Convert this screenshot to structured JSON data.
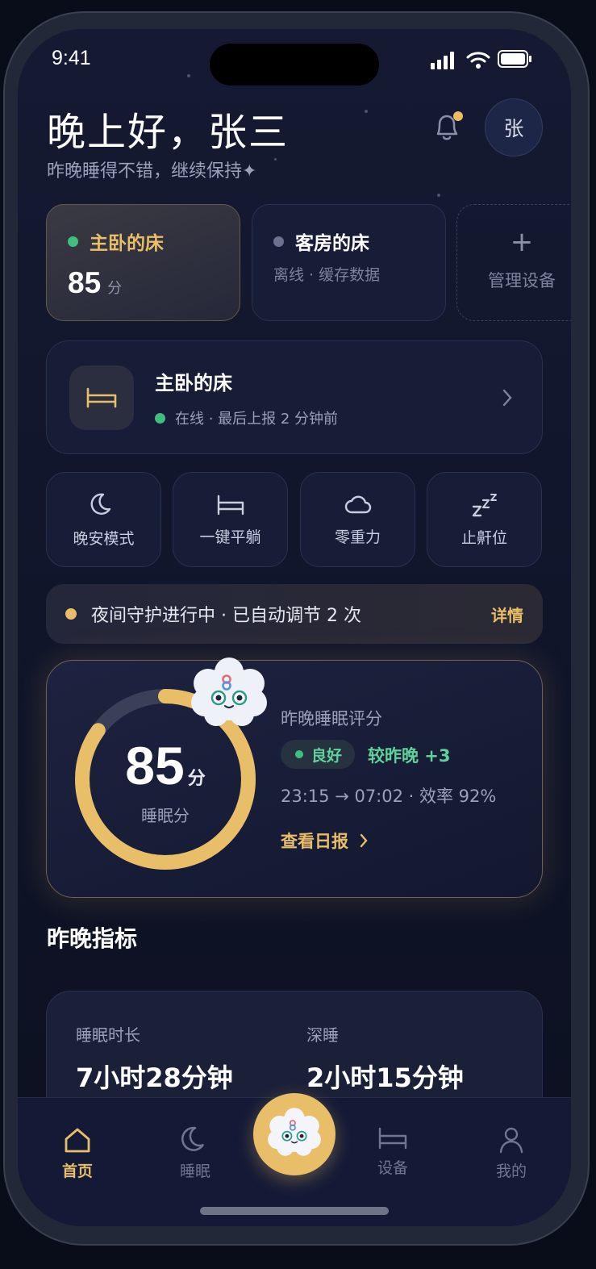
{
  "status_bar": {
    "time": "9:41"
  },
  "header": {
    "greeting": "晚上好，张三",
    "subtitle": "昨晚睡得不错，继续保持",
    "sparkle": "✦",
    "avatar_initial": "张"
  },
  "devices": [
    {
      "name": "主卧的床",
      "score": "85",
      "unit": "分",
      "status_color": "#3fbf7f"
    },
    {
      "name": "客房的床",
      "subtitle": "离线 · 缓存数据",
      "status_color": "#6b7290"
    },
    {
      "plus": "+",
      "label": "管理设备"
    }
  ],
  "bed_card": {
    "name": "主卧的床",
    "status": "在线 · 最后上报 2 分钟前"
  },
  "actions": [
    {
      "label": "晚安模式",
      "icon": "moon-icon"
    },
    {
      "label": "一键平躺",
      "icon": "bed-icon"
    },
    {
      "label": "零重力",
      "icon": "cloud-icon"
    },
    {
      "label": "止鼾位",
      "icon": "zzz-icon"
    }
  ],
  "guard": {
    "text": "夜间守护进行中 · 已自动调节 2 次",
    "detail": "详情"
  },
  "sleep_score": {
    "score": "85",
    "unit": "分",
    "ring_label": "睡眠分",
    "ring_fraction": 0.85,
    "title": "昨晚睡眠评分",
    "quality": "良好",
    "compare": "较昨晚 +3",
    "times": "23:15 → 07:02 · 效率 92%",
    "link": "查看日报"
  },
  "metrics": {
    "section_title": "昨晚指标",
    "items": [
      {
        "label": "睡眠时长",
        "value": "7小时28分钟"
      },
      {
        "label": "深睡",
        "value": "2小时15分钟"
      }
    ]
  },
  "nav": {
    "home": "首页",
    "sleep": "睡眠",
    "device": "设备",
    "me": "我的"
  },
  "colors": {
    "accent": "#e9be68",
    "online": "#3fbf7f",
    "background": "#10152a"
  }
}
